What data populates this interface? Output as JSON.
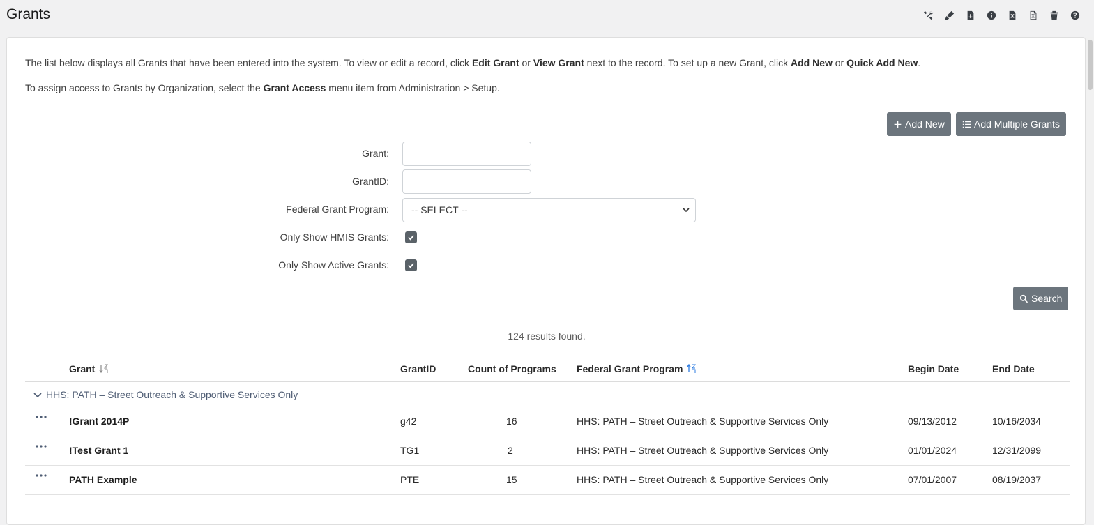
{
  "page": {
    "title": "Grants"
  },
  "toolbar_icons": [
    "tools-icon",
    "highlighter-icon",
    "file-download-icon",
    "info-icon",
    "excel-icon",
    "excel-export-icon",
    "trash-icon",
    "help-icon"
  ],
  "intro": {
    "line1_a": "The list below displays all Grants that have been entered into the system.  To view or edit a record, click ",
    "line1_b": "Edit Grant",
    "line1_c": " or ",
    "line1_d": "View Grant",
    "line1_e": " next to the record.  To set up a new Grant, click ",
    "line1_f": "Add New",
    "line1_g": " or ",
    "line1_h": "Quick Add New",
    "line1_i": ".",
    "line2_a": "To assign access to Grants by Organization, select the ",
    "line2_b": "Grant Access",
    "line2_c": " menu item from Administration > Setup."
  },
  "buttons": {
    "add_new": "Add New",
    "add_multiple": "Add Multiple Grants",
    "search": "Search"
  },
  "filters": {
    "grant_label": "Grant:",
    "grant_value": "",
    "grantid_label": "GrantID:",
    "grantid_value": "",
    "program_label": "Federal Grant Program:",
    "program_selected": "-- SELECT --",
    "hmis_label": "Only Show HMIS Grants:",
    "hmis_checked": true,
    "active_label": "Only Show Active Grants:",
    "active_checked": true
  },
  "results_text": "124 results found.",
  "table": {
    "headers": {
      "grant": "Grant",
      "grantid": "GrantID",
      "count": "Count of Programs",
      "program": "Federal Grant Program",
      "begin": "Begin Date",
      "end": "End Date"
    },
    "group_label": "HHS: PATH – Street Outreach & Supportive Services Only",
    "rows": [
      {
        "grant": "!Grant 2014P",
        "grantid": "g42",
        "count": "16",
        "program": "HHS: PATH – Street Outreach & Supportive Services Only",
        "begin": "09/13/2012",
        "end": "10/16/2034"
      },
      {
        "grant": "!Test Grant 1",
        "grantid": "TG1",
        "count": "2",
        "program": "HHS: PATH – Street Outreach & Supportive Services Only",
        "begin": "01/01/2024",
        "end": "12/31/2099"
      },
      {
        "grant": "PATH Example",
        "grantid": "PTE",
        "count": "15",
        "program": "HHS: PATH – Street Outreach & Supportive Services Only",
        "begin": "07/01/2007",
        "end": "08/19/2037"
      }
    ]
  }
}
